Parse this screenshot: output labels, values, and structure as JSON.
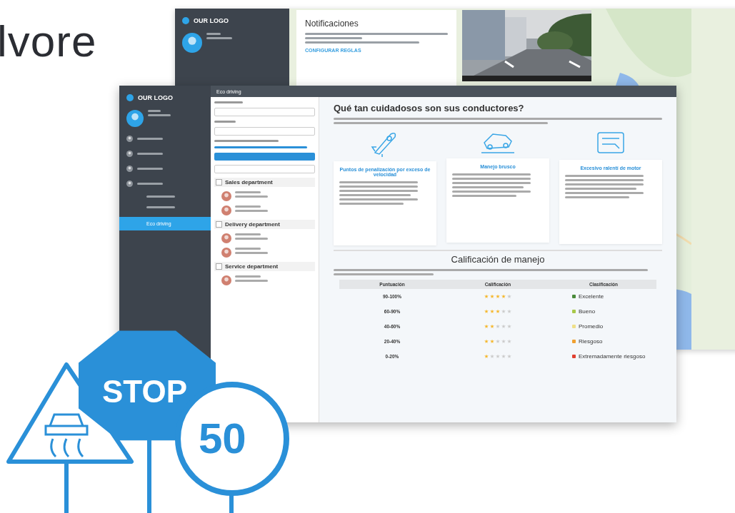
{
  "brand": {
    "text": "lvore"
  },
  "back_window": {
    "logo": "OUR LOGO",
    "notification": {
      "title": "Notificaciones",
      "link": "CONFIGURAR REGLAS"
    }
  },
  "front_window": {
    "title": "Eco driving",
    "logo": "OUR LOGO",
    "nav": [
      {
        "kind": "icon"
      },
      {
        "kind": "icon"
      },
      {
        "kind": "icon"
      },
      {
        "kind": "group"
      },
      {
        "kind": "sub"
      },
      {
        "kind": "sub"
      },
      {
        "kind": "active",
        "label": "Eco driving"
      }
    ],
    "groups": [
      {
        "name": "Sales department",
        "drivers": [
          {
            "kind": "driver"
          },
          {
            "kind": "driver"
          }
        ]
      },
      {
        "name": "Delivery department",
        "drivers": [
          {
            "kind": "driver"
          },
          {
            "kind": "driver"
          }
        ]
      },
      {
        "name": "Service department",
        "drivers": [
          {
            "kind": "driver"
          }
        ]
      }
    ],
    "heading": "Qué tan cuidadosos son sus conductores?",
    "cards": [
      {
        "title": "Puntos de penalización por exceso de velocidad"
      },
      {
        "title": "Manejo brusco"
      },
      {
        "title": "Excesivo ralentí de motor"
      }
    ],
    "rating": {
      "title": "Calificación de manejo",
      "columns": [
        "Puntuación",
        "Calificación",
        "Clasificación"
      ],
      "rows": [
        {
          "score": "90-100%",
          "stars": 4,
          "class": "Excelente",
          "color": "#4a8a3a"
        },
        {
          "score": "60-90%",
          "stars": 3,
          "class": "Bueno",
          "color": "#a8c84a"
        },
        {
          "score": "40-60%",
          "stars": 2,
          "class": "Promedio",
          "color": "#efe08a"
        },
        {
          "score": "20-40%",
          "stars": 2,
          "class": "Riesgoso",
          "color": "#f0a030"
        },
        {
          "score": "0-20%",
          "stars": 1,
          "class": "Extremadamente riesgoso",
          "color": "#e04030"
        }
      ]
    }
  },
  "signs": {
    "stop": "STOP",
    "speed": "50"
  }
}
